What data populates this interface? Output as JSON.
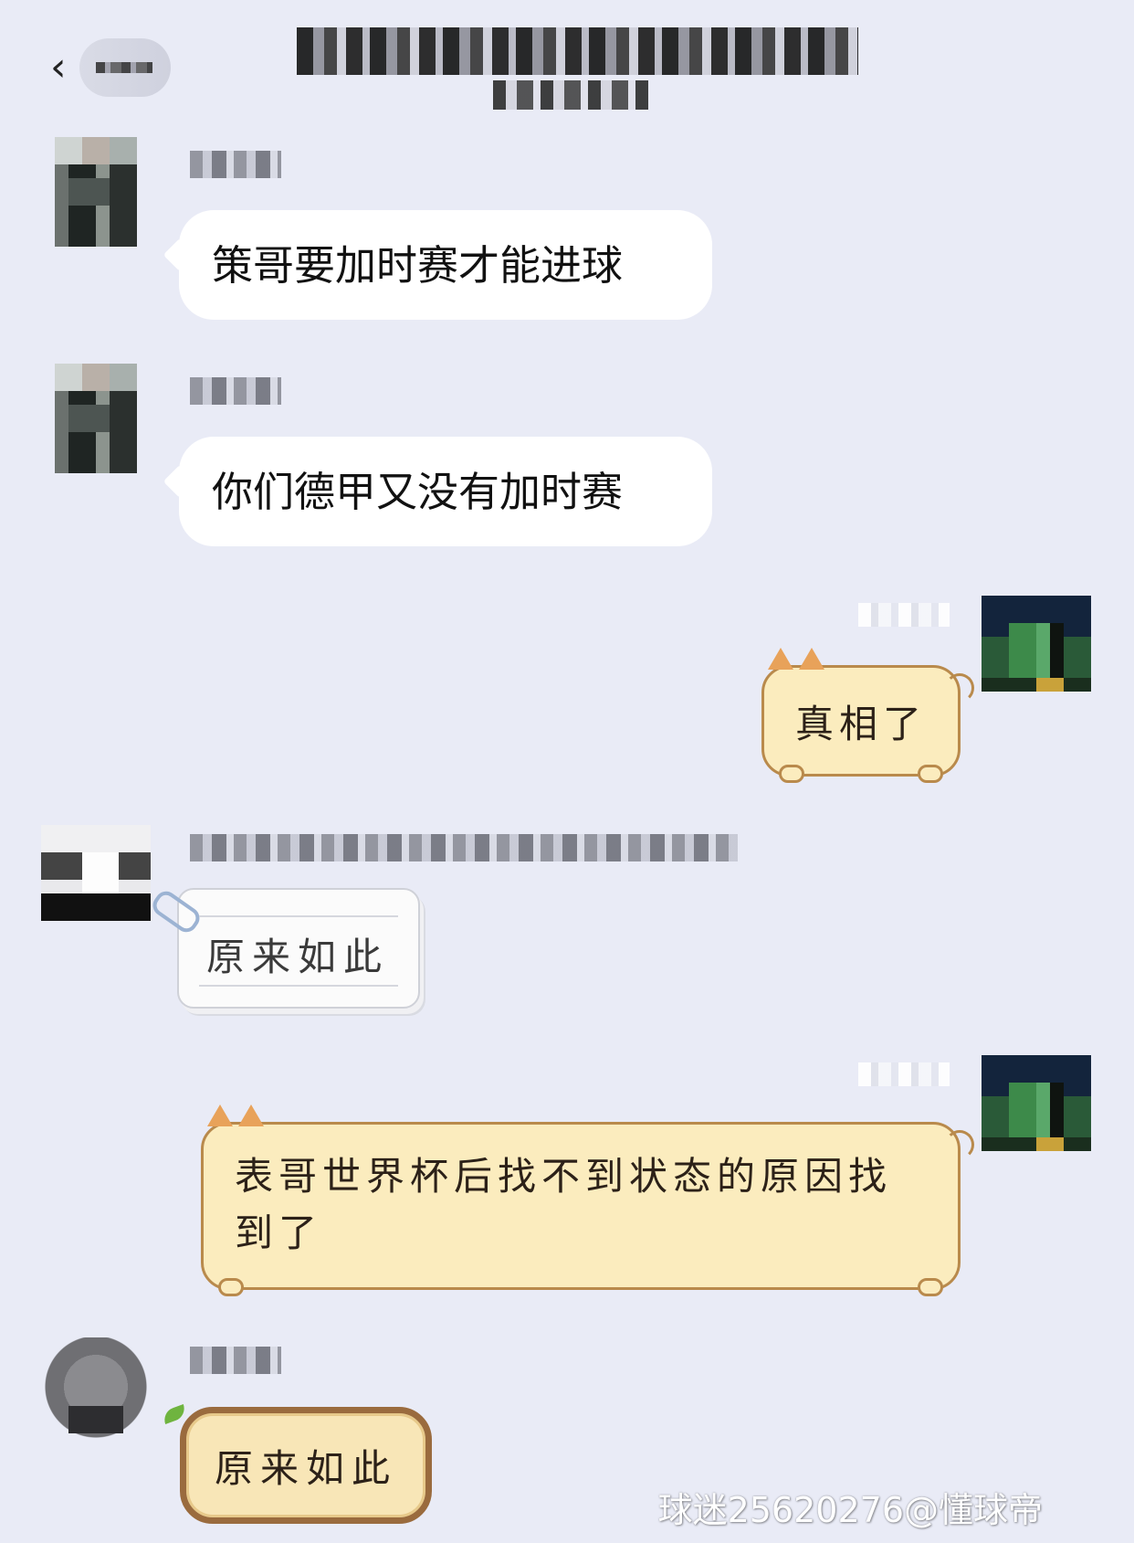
{
  "header": {
    "back_icon": "chevron-left-icon"
  },
  "messages": [
    {
      "side": "left",
      "text": "策哥要加时赛才能进球",
      "bubble": "white"
    },
    {
      "side": "left",
      "text": "你们德甲又没有加时赛",
      "bubble": "white"
    },
    {
      "side": "right",
      "text": "真相了",
      "bubble": "cat"
    },
    {
      "side": "left",
      "text": "原来如此",
      "bubble": "note"
    },
    {
      "side": "right",
      "text": "表哥世界杯后找不到状态的原因找到了",
      "bubble": "cat"
    },
    {
      "side": "left",
      "text": "原来如此",
      "bubble": "wood"
    }
  ],
  "watermark": "球迷25620276@懂球帝",
  "colors": {
    "background": "#e9ebf6",
    "bubble_white": "#ffffff",
    "bubble_cat": "#fbecbe",
    "bubble_cat_border": "#b98a4c"
  }
}
